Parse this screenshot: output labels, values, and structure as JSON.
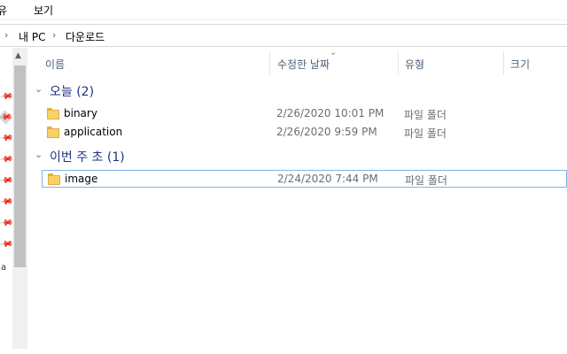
{
  "menu": {
    "share_label": "유",
    "view_label": "보기"
  },
  "address": {
    "chevron": "›",
    "crumbs": [
      "내 PC",
      "다운로드"
    ]
  },
  "nav": {
    "pin_glyph": "📌",
    "letter": "a"
  },
  "columns": {
    "name": "이름",
    "date": "수정한 날짜",
    "type": "유형",
    "size": "크기",
    "sort_glyph": "⌄"
  },
  "groups": [
    {
      "title": "오늘 (2)",
      "chevron": "⌄",
      "items": [
        {
          "name": "binary",
          "date": "2/26/2020 10:01 PM",
          "type": "파일 폴더",
          "icon": "folder-icon"
        },
        {
          "name": "application",
          "date": "2/26/2020 9:59 PM",
          "type": "파일 폴더",
          "icon": "folder-icon"
        }
      ]
    },
    {
      "title": "이번 주 초 (1)",
      "chevron": "⌄",
      "items": [
        {
          "name": "image",
          "date": "2/24/2020 7:44 PM",
          "type": "파일 폴더",
          "icon": "folder-icon"
        }
      ]
    }
  ],
  "scrollbar": {
    "up_arrow": "▲"
  }
}
